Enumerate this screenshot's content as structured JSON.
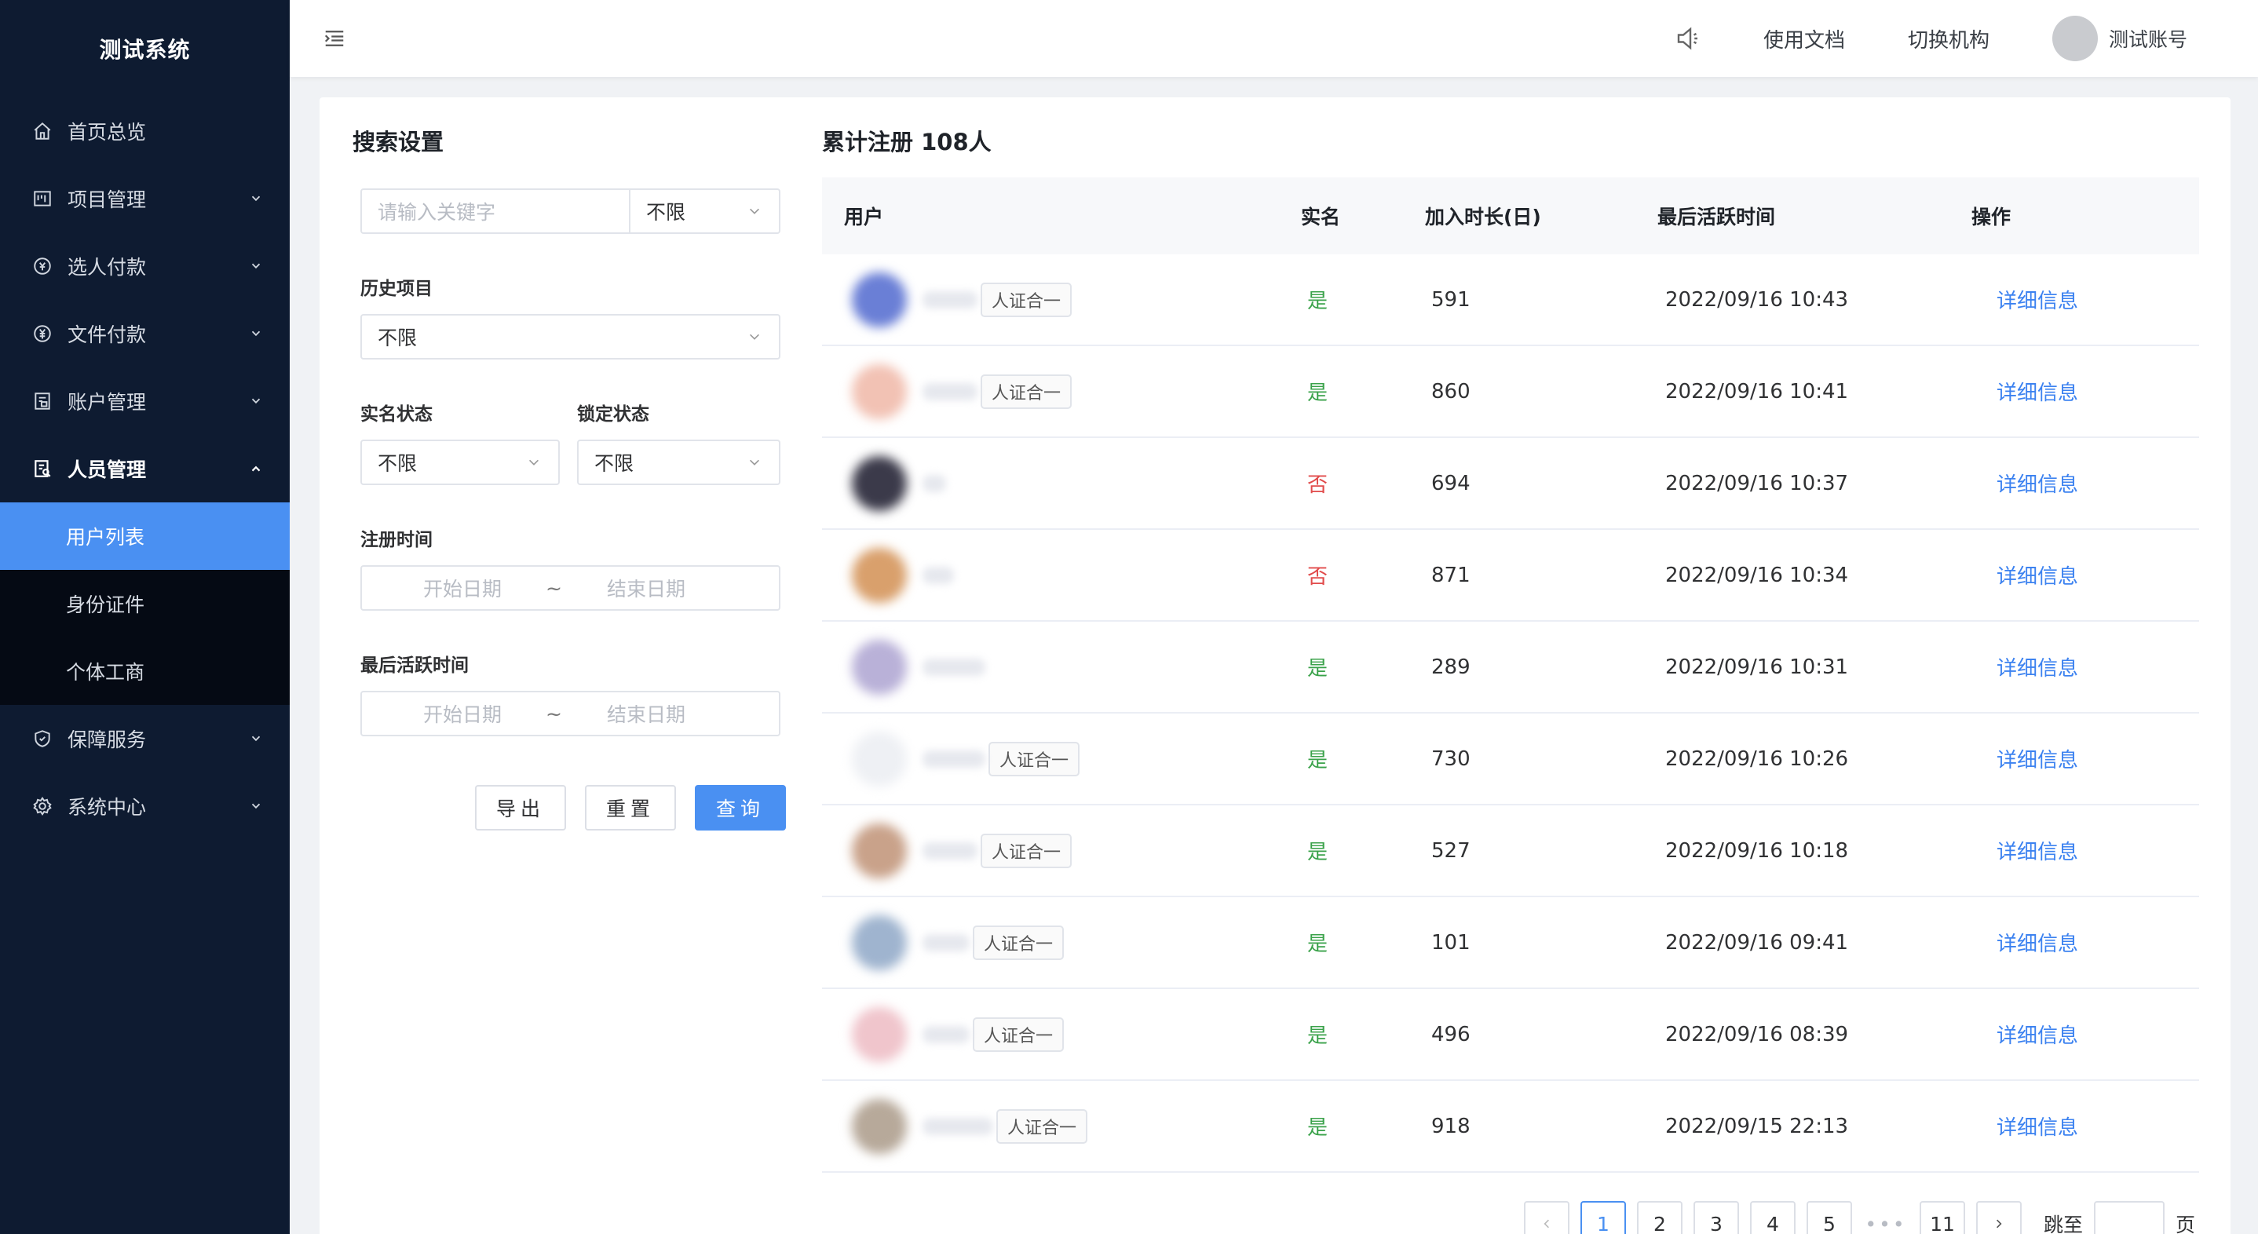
{
  "app": {
    "title": "测试系统"
  },
  "sidebar": {
    "items": [
      {
        "label": "首页总览",
        "icon": "home-icon"
      },
      {
        "label": "项目管理",
        "icon": "project-icon"
      },
      {
        "label": "选人付款",
        "icon": "payment-icon"
      },
      {
        "label": "文件付款",
        "icon": "yen-icon"
      },
      {
        "label": "账户管理",
        "icon": "account-icon"
      },
      {
        "label": "人员管理",
        "icon": "people-icon"
      },
      {
        "label": "保障服务",
        "icon": "shield-icon"
      },
      {
        "label": "系统中心",
        "icon": "gear-icon"
      }
    ],
    "submenu": [
      {
        "label": "用户列表"
      },
      {
        "label": "身份证件"
      },
      {
        "label": "个体工商"
      }
    ]
  },
  "header": {
    "docs_label": "使用文档",
    "switch_label": "切换机构",
    "user_name": "测试账号"
  },
  "filters": {
    "title": "搜索设置",
    "keyword_placeholder": "请输入关键字",
    "keyword_scope": "不限",
    "history_label": "历史项目",
    "history_value": "不限",
    "realname_label": "实名状态",
    "realname_value": "不限",
    "lock_label": "锁定状态",
    "lock_value": "不限",
    "register_label": "注册时间",
    "active_label": "最后活跃时间",
    "start_placeholder": "开始日期",
    "end_placeholder": "结束日期",
    "range_sep": "~",
    "export_label": "导出",
    "reset_label": "重置",
    "query_label": "查询"
  },
  "table": {
    "title": "累计注册 108人",
    "columns": [
      "用户",
      "实名",
      "加入时长(日)",
      "最后活跃时间",
      "操作"
    ],
    "tag_label": "人证合一",
    "action_label": "详细信息",
    "rows": [
      {
        "verified": "是",
        "days": "591",
        "last_active": "2022/09/16 10:43",
        "tag": true,
        "avatar_color": "#6a7fd6"
      },
      {
        "verified": "是",
        "days": "860",
        "last_active": "2022/09/16 10:41",
        "tag": true,
        "avatar_color": "#f2c2b4"
      },
      {
        "verified": "否",
        "days": "694",
        "last_active": "2022/09/16 10:37",
        "tag": false,
        "avatar_color": "#3b3a4a"
      },
      {
        "verified": "否",
        "days": "871",
        "last_active": "2022/09/16 10:34",
        "tag": false,
        "avatar_color": "#d9a06c"
      },
      {
        "verified": "是",
        "days": "289",
        "last_active": "2022/09/16 10:31",
        "tag": false,
        "avatar_color": "#b9b1d8"
      },
      {
        "verified": "是",
        "days": "730",
        "last_active": "2022/09/16 10:26",
        "tag": true,
        "avatar_color": "#eef0f4"
      },
      {
        "verified": "是",
        "days": "527",
        "last_active": "2022/09/16 10:18",
        "tag": true,
        "avatar_color": "#c9a28a"
      },
      {
        "verified": "是",
        "days": "101",
        "last_active": "2022/09/16 09:41",
        "tag": true,
        "avatar_color": "#9fb4cf"
      },
      {
        "verified": "是",
        "days": "496",
        "last_active": "2022/09/16 08:39",
        "tag": true,
        "avatar_color": "#f0c5cc"
      },
      {
        "verified": "是",
        "days": "918",
        "last_active": "2022/09/15 22:13",
        "tag": true,
        "avatar_color": "#b7a99a"
      }
    ]
  },
  "pagination": {
    "pages": [
      "1",
      "2",
      "3",
      "4",
      "5"
    ],
    "ellipsis": "•••",
    "last_page": "11",
    "current": "1",
    "jump_label": "跳至",
    "page_suffix": "页"
  }
}
